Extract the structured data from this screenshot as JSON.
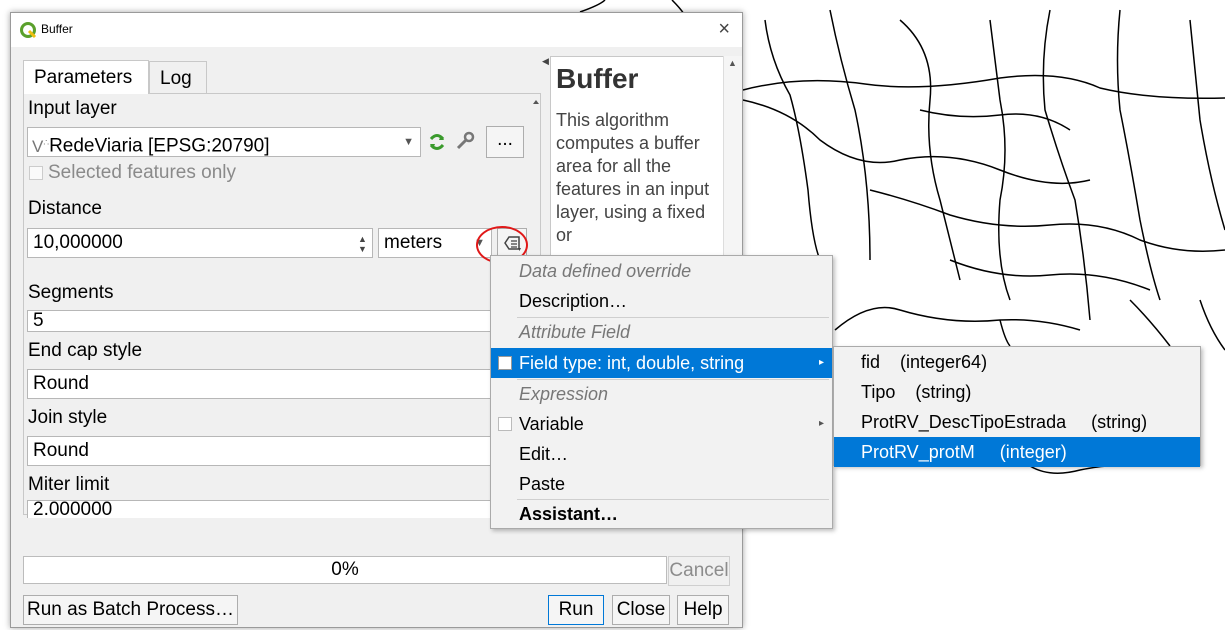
{
  "window": {
    "title": "Buffer",
    "close": "×"
  },
  "tabs": [
    "Parameters",
    "Log"
  ],
  "params": {
    "input_layer_label": "Input layer",
    "input_layer_value": "RedeViaria [EPSG:20790]",
    "selected_only": "Selected features only",
    "browse": "...",
    "distance_label": "Distance",
    "distance_value": "10,000000",
    "distance_unit": "meters",
    "segments_label": "Segments",
    "segments_value": "5",
    "endcap_label": "End cap style",
    "endcap_value": "Round",
    "join_label": "Join style",
    "join_value": "Round",
    "miter_label": "Miter limit",
    "miter_value": "2.000000"
  },
  "help": {
    "title": "Buffer",
    "text": "This algorithm computes a buffer area for all the features in an input layer, using a fixed or"
  },
  "progress": {
    "text": "0%",
    "value": 0
  },
  "buttons": {
    "cancel": "Cancel",
    "batch": "Run as Batch Process…",
    "run": "Run",
    "close": "Close",
    "help": "Help"
  },
  "menu": {
    "items": [
      "Data defined override",
      "Description…",
      "Attribute Field",
      "Field type: int, double, string",
      "Expression",
      "Variable",
      "Edit…",
      "Paste",
      "Assistant…"
    ]
  },
  "submenu": {
    "items": [
      "fid    (integer64)",
      "Tipo    (string)",
      "ProtRV_DescTipoEstrada     (string)",
      "ProtRV_protM     (integer)"
    ]
  },
  "colors": {
    "selection": "#0078d7",
    "highlight_circle": "#e01818",
    "qgis_green": "#5aa02c"
  },
  "icons": [
    "qgis-logo-icon",
    "vector-layer-icon",
    "iterate-icon",
    "wrench-icon",
    "data-defined-icon"
  ]
}
